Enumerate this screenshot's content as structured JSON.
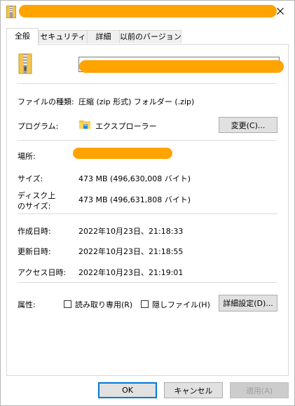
{
  "tabs": [
    {
      "label": "全般",
      "active": true
    },
    {
      "label": "セキュリティ",
      "active": false
    },
    {
      "label": "詳細",
      "active": false
    },
    {
      "label": "以前のバージョン",
      "active": false
    }
  ],
  "general": {
    "file_type_label": "ファイルの種類:",
    "file_type_value": "圧縮 (zip 形式) フォルダー (.zip)",
    "program_label": "プログラム:",
    "program_value": "エクスプローラー",
    "change_button": "変更(C)...",
    "location_label": "場所:",
    "size_label": "サイズ:",
    "size_value": "473 MB (496,630,008 バイト)",
    "disk_size_label_1": "ディスク上",
    "disk_size_label_2": "のサイズ:",
    "disk_size_value": "473 MB (496,631,808 バイト)",
    "created_label": "作成日時:",
    "created_value": "2022年10月23日、21:18:33",
    "modified_label": "更新日時:",
    "modified_value": "2022年10月23日、21:18:55",
    "accessed_label": "アクセス日時:",
    "accessed_value": "2022年10月23日、21:19:01",
    "attributes_label": "属性:",
    "readonly_label": "読み取り専用(R)",
    "hidden_label": "隠しファイル(H)",
    "advanced_button": "詳細設定(D)..."
  },
  "footer": {
    "ok": "OK",
    "cancel": "キャンセル",
    "apply": "適用(A)"
  },
  "colors": {
    "accent": "#0078d7",
    "redaction": "#ffa300"
  },
  "icons": {
    "title": "zip-folder-icon",
    "file": "zip-folder-icon",
    "program": "file-explorer-icon",
    "close": "close-icon"
  }
}
